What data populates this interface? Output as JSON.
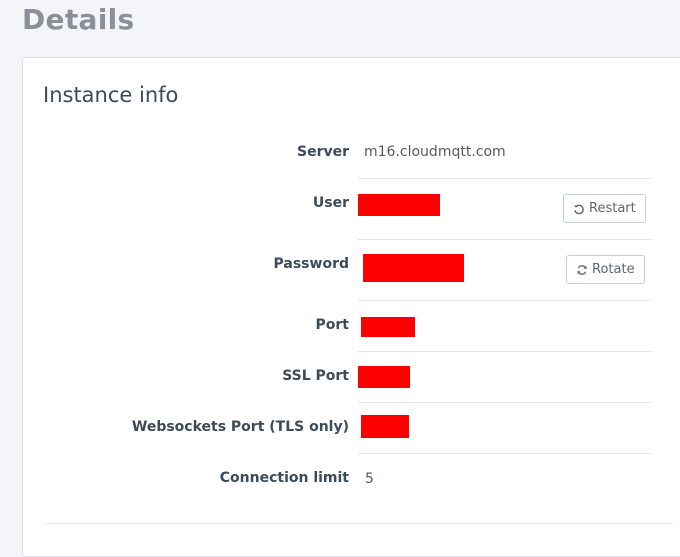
{
  "page": {
    "title": "Details"
  },
  "card": {
    "title": "Instance info",
    "rows": {
      "server": {
        "label": "Server",
        "value": "m16.cloudmqtt.com"
      },
      "user": {
        "label": "User"
      },
      "password": {
        "label": "Password"
      },
      "port": {
        "label": "Port"
      },
      "ssl_port": {
        "label": "SSL Port"
      },
      "websockets_port": {
        "label": "Websockets Port (TLS only)"
      },
      "connection_limit": {
        "label": "Connection limit",
        "value": "5"
      }
    },
    "buttons": {
      "restart": {
        "label": "Restart",
        "icon": "rotate-ccw-icon"
      },
      "rotate": {
        "label": "Rotate",
        "icon": "refresh-icon"
      }
    }
  },
  "colors": {
    "redaction": "#ff0000",
    "title_gray": "#8a8f99",
    "text_dark": "#3d4a59"
  }
}
